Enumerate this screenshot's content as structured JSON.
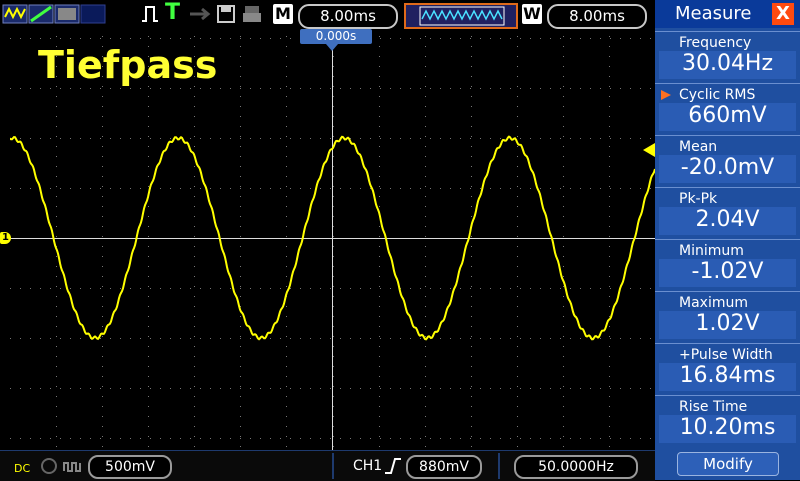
{
  "toolbar": {
    "m_label": "M",
    "timebase": "8.00ms",
    "w_label": "W",
    "window_timebase": "8.00ms",
    "trigger_status": "T"
  },
  "plot": {
    "title": "Tiefpass",
    "trigger_position": "0.000s",
    "channel_marker": "1",
    "trace_color": "#ffff00"
  },
  "bottom": {
    "coupling": "DC",
    "ch1_scale": "500mV",
    "trigger_source": "CH1",
    "trigger_level": "880mV",
    "frequency_counter": "50.0000Hz"
  },
  "measure": {
    "title": "Measure",
    "close": "X",
    "items": [
      {
        "label": "Frequency",
        "value": "30.04Hz"
      },
      {
        "label": "Cyclic RMS",
        "value": "660mV"
      },
      {
        "label": "Mean",
        "value": "-20.0mV"
      },
      {
        "label": "Pk-Pk",
        "value": "2.04V"
      },
      {
        "label": "Minimum",
        "value": "-1.02V"
      },
      {
        "label": "Maximum",
        "value": "1.02V"
      },
      {
        "label": "+Pulse Width",
        "value": "16.84ms"
      },
      {
        "label": "Rise Time",
        "value": "10.20ms"
      }
    ],
    "selected_index": 1,
    "modify": "Modify"
  },
  "colors": {
    "panel_blue": "#1f4fa0",
    "trace_yellow": "#ffff00",
    "accent_orange": "#ff4a10"
  }
}
